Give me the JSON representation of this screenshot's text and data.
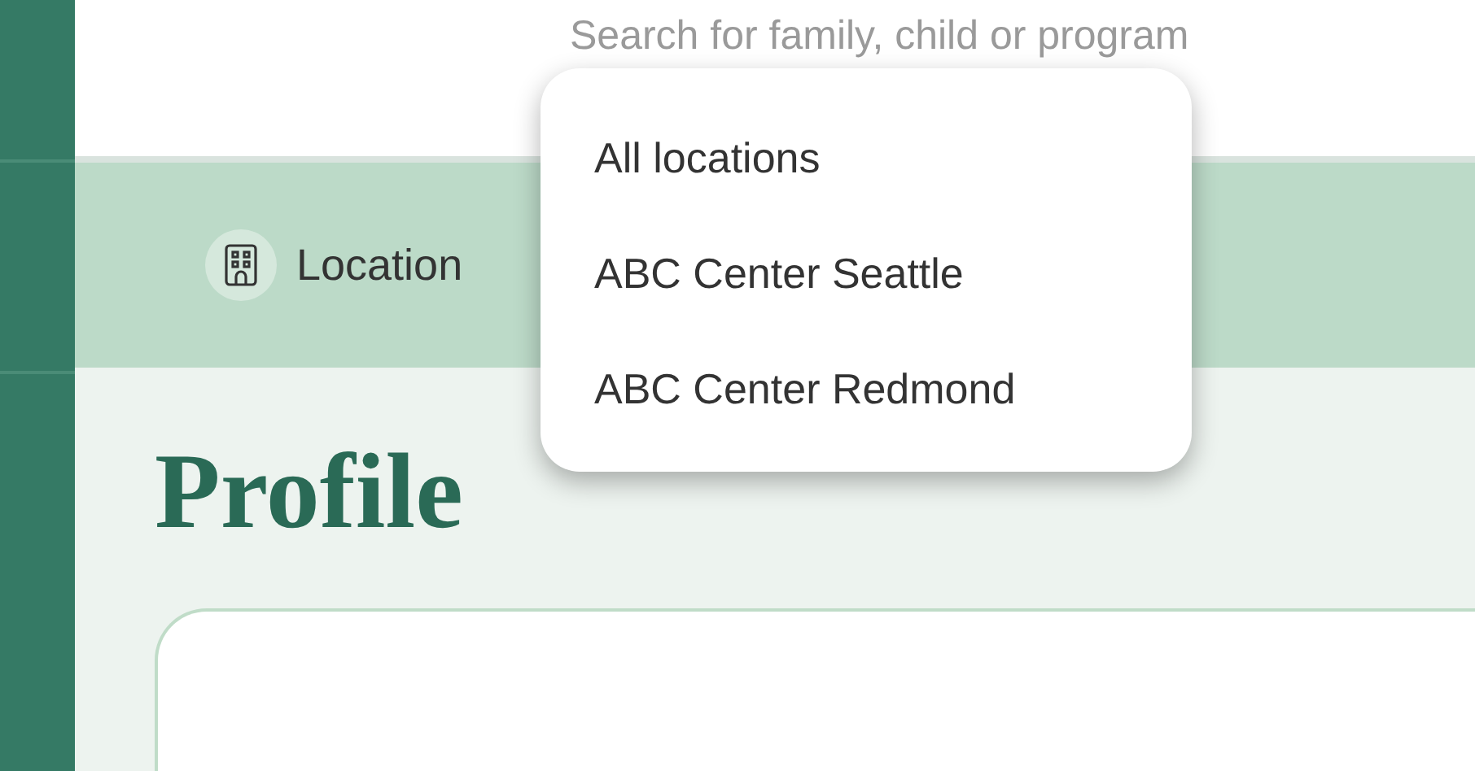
{
  "search": {
    "placeholder": "Search for family, child or program"
  },
  "location_bar": {
    "label": "Location"
  },
  "location_menu": {
    "items": [
      {
        "label": "All locations"
      },
      {
        "label": "ABC Center Seattle"
      },
      {
        "label": "ABC Center Redmond"
      }
    ]
  },
  "page": {
    "title": "Profile"
  }
}
